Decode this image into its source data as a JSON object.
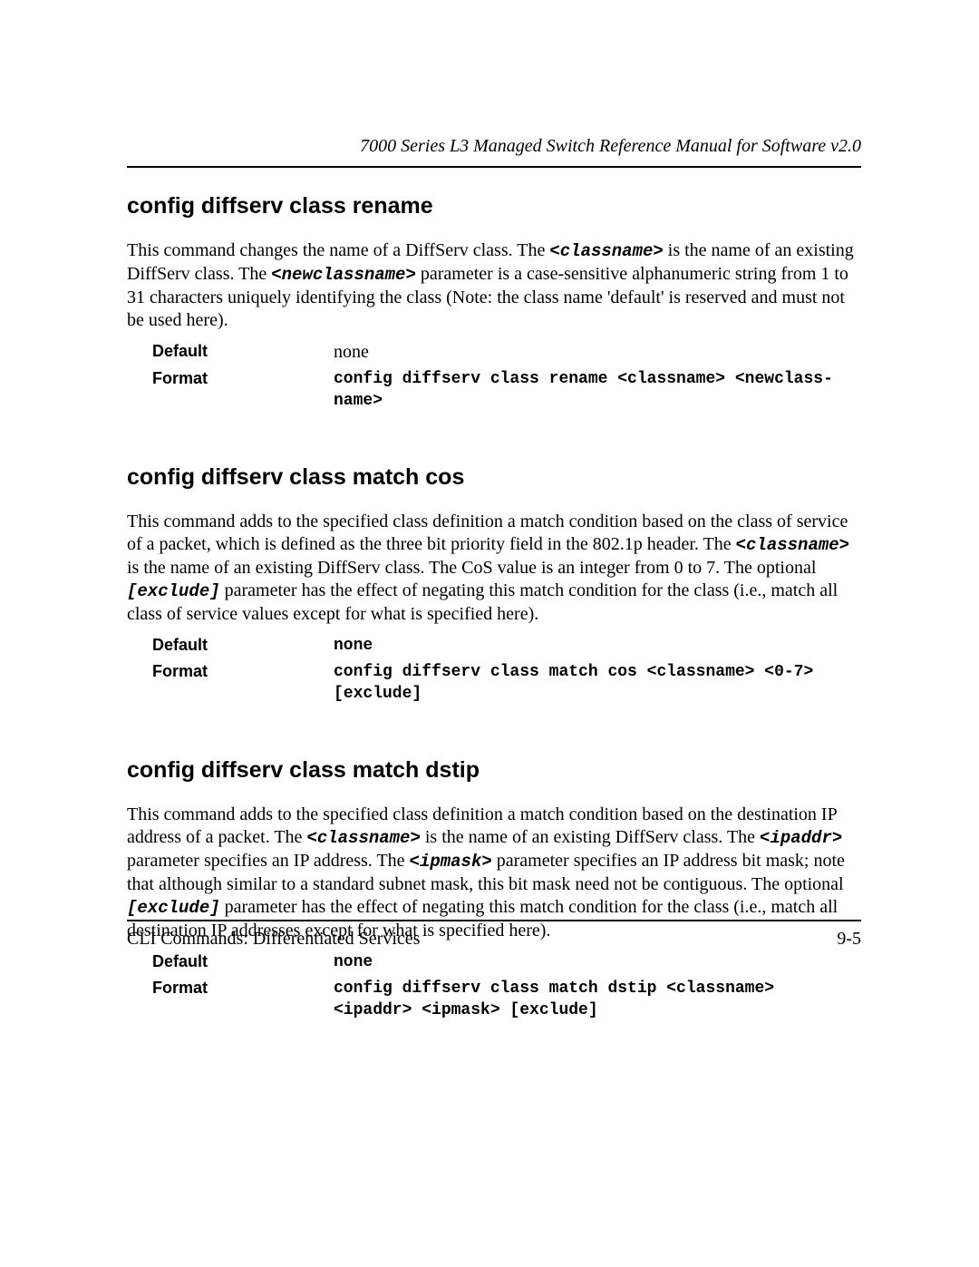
{
  "header": {
    "running_title": "7000 Series L3 Managed Switch Reference Manual for Software v2.0"
  },
  "sections": [
    {
      "title": "config diffserv class rename",
      "para_parts": [
        {
          "t": "This command changes the name of a DiffServ class. The ",
          "cls": ""
        },
        {
          "t": "<classname>",
          "cls": "monobi"
        },
        {
          "t": " is the name of an existing DiffServ class. The ",
          "cls": ""
        },
        {
          "t": "<newclassname>",
          "cls": "monobi"
        },
        {
          "t": " parameter is a case-sensitive alphanumeric string from 1 to 31 characters uniquely identifying the class (Note: the class name 'default' is reserved and must not be used here).",
          "cls": ""
        }
      ],
      "default": "none",
      "format": "config diffserv class rename <classname> <newclass-name>"
    },
    {
      "title": "config diffserv class match cos",
      "para_parts": [
        {
          "t": "This command adds to the specified class definition a match condition based on the class of service of a packet, which is defined as the three bit priority field in the 802.1p header. The ",
          "cls": ""
        },
        {
          "t": "<classname>",
          "cls": "monobi"
        },
        {
          "t": " is the name of an existing DiffServ class. The CoS value is an integer from 0 to 7. The optional ",
          "cls": ""
        },
        {
          "t": "[exclude]",
          "cls": "monobi"
        },
        {
          "t": " parameter has the effect of negating this match condition for the class (i.e., match all class of service values except for what is specified here).",
          "cls": ""
        }
      ],
      "default": "none",
      "format": "config diffserv class match cos <classname> <0-7> [exclude]"
    },
    {
      "title": "config diffserv class match dstip",
      "para_parts": [
        {
          "t": "This command adds to the specified class definition a match condition based on the destination IP address of a packet. The ",
          "cls": ""
        },
        {
          "t": "<classname>",
          "cls": "monobi"
        },
        {
          "t": " is the name of an existing DiffServ class. The ",
          "cls": ""
        },
        {
          "t": "<ipaddr>",
          "cls": "monobi"
        },
        {
          "t": " parameter specifies an IP address. The ",
          "cls": ""
        },
        {
          "t": "<ipmask>",
          "cls": "monobi"
        },
        {
          "t": " parameter specifies an IP address bit mask; note that although similar to a standard subnet mask, this bit mask need not be contiguous. The optional ",
          "cls": ""
        },
        {
          "t": "[exclude]",
          "cls": "monobi"
        },
        {
          "t": " parameter has the effect of negating this match condition for the class (i.e., match all destination IP addresses except for what is specified here).",
          "cls": ""
        }
      ],
      "default": "none",
      "format": "config diffserv class match dstip <classname> <ipaddr> <ipmask> [exclude]"
    }
  ],
  "labels": {
    "default": "Default",
    "format": "Format"
  },
  "footer": {
    "left": "CLI Commands: Differentiated Services",
    "right": "9-5"
  }
}
